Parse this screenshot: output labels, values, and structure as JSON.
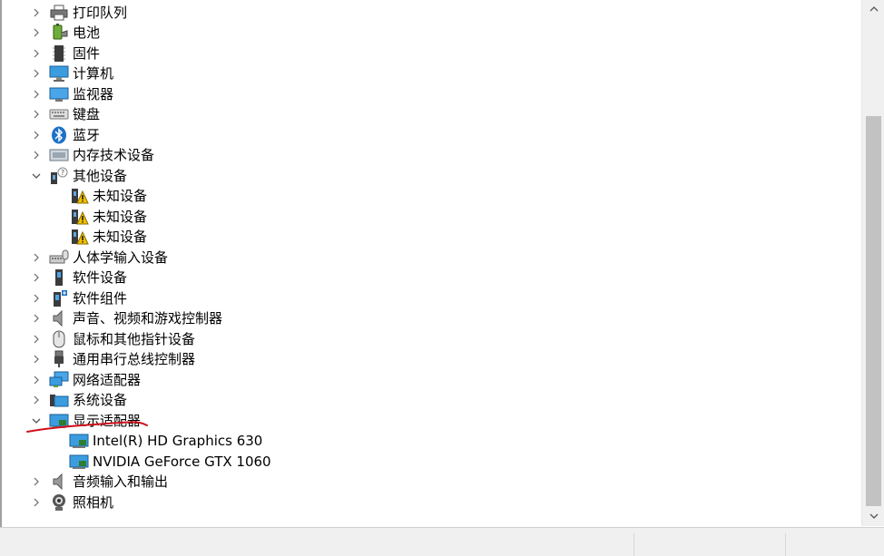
{
  "tree": {
    "items": [
      {
        "label": "打印队列",
        "icon": "printer-icon",
        "expanded": false
      },
      {
        "label": "电池",
        "icon": "battery-icon",
        "expanded": false
      },
      {
        "label": "固件",
        "icon": "firmware-chip-icon",
        "expanded": false
      },
      {
        "label": "计算机",
        "icon": "computer-icon",
        "expanded": false
      },
      {
        "label": "监视器",
        "icon": "monitor-icon",
        "expanded": false
      },
      {
        "label": "键盘",
        "icon": "keyboard-icon",
        "expanded": false
      },
      {
        "label": "蓝牙",
        "icon": "bluetooth-icon",
        "expanded": false
      },
      {
        "label": "内存技术设备",
        "icon": "memory-device-icon",
        "expanded": false
      },
      {
        "label": "其他设备",
        "icon": "unknown-device-icon",
        "expanded": true,
        "children": [
          {
            "label": "未知设备",
            "icon": "warning-device-icon"
          },
          {
            "label": "未知设备",
            "icon": "warning-device-icon"
          },
          {
            "label": "未知设备",
            "icon": "warning-device-icon"
          }
        ]
      },
      {
        "label": "人体学输入设备",
        "icon": "hid-icon",
        "expanded": false
      },
      {
        "label": "软件设备",
        "icon": "software-device-icon",
        "expanded": false
      },
      {
        "label": "软件组件",
        "icon": "software-component-icon",
        "expanded": false
      },
      {
        "label": "声音、视频和游戏控制器",
        "icon": "speaker-icon",
        "expanded": false
      },
      {
        "label": "鼠标和其他指针设备",
        "icon": "mouse-icon",
        "expanded": false
      },
      {
        "label": "通用串行总线控制器",
        "icon": "usb-icon",
        "expanded": false
      },
      {
        "label": "网络适配器",
        "icon": "network-adapter-icon",
        "expanded": false
      },
      {
        "label": "系统设备",
        "icon": "system-device-icon",
        "expanded": false
      },
      {
        "label": "显示适配器",
        "icon": "display-adapter-icon",
        "expanded": true,
        "children": [
          {
            "label": "Intel(R) HD Graphics 630",
            "icon": "display-adapter-icon"
          },
          {
            "label": "NVIDIA GeForce GTX 1060",
            "icon": "display-adapter-icon"
          }
        ]
      },
      {
        "label": "音频输入和输出",
        "icon": "speaker-icon",
        "expanded": false
      },
      {
        "label": "照相机",
        "icon": "camera-icon",
        "expanded": false
      }
    ]
  },
  "annotation": {
    "color": "#d0101a"
  },
  "colors": {
    "accent": "#1e88d8",
    "warning": "#f2c200"
  }
}
